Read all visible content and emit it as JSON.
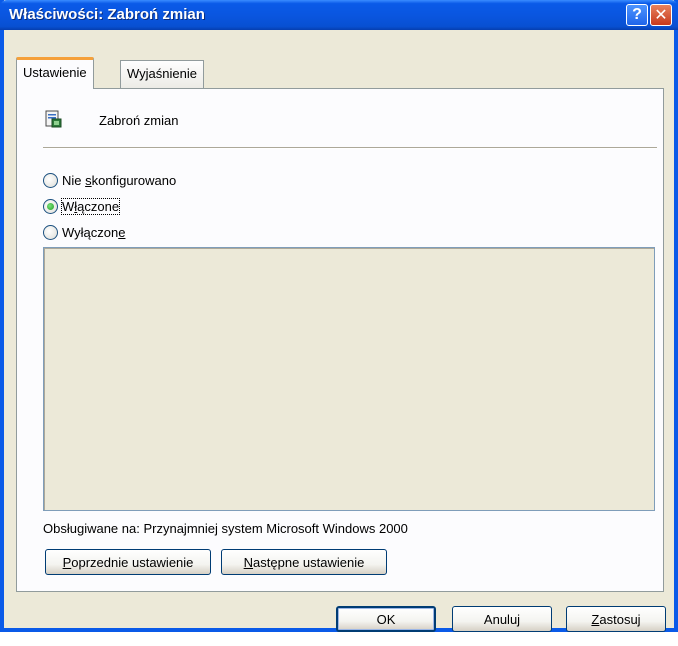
{
  "window": {
    "title": "Właściwości: Zabroń zmian",
    "help_glyph": "?",
    "close_glyph": "✕"
  },
  "tabs": [
    {
      "label": "Ustawienie",
      "active": true
    },
    {
      "label": "Wyjaśnienie",
      "active": false
    }
  ],
  "policy": {
    "icon": "policy-settings-icon",
    "name": "Zabroń zmian"
  },
  "radios": [
    {
      "pre": "Nie ",
      "u": "s",
      "post": "konfigurowano",
      "checked": false
    },
    {
      "pre": "W",
      "u": "ł",
      "post": "ączone",
      "checked": true
    },
    {
      "pre": "Wyłączon",
      "u": "e",
      "post": "",
      "checked": false
    }
  ],
  "supported": {
    "label": "Obsługiwane na:",
    "value": "Przynajmniej system Microsoft Windows 2000"
  },
  "nav_buttons": {
    "prev": {
      "u": "P",
      "rest": "oprzednie ustawienie"
    },
    "next": {
      "u": "N",
      "rest": "astępne ustawienie"
    }
  },
  "footer_buttons": {
    "ok": "OK",
    "cancel": "Anuluj",
    "apply": {
      "u": "Z",
      "rest": "astosuj"
    }
  },
  "colors": {
    "titlebar": "#0a5ae8",
    "dialog_bg": "#ece9d8",
    "tab_active_highlight": "#f5a03a"
  }
}
